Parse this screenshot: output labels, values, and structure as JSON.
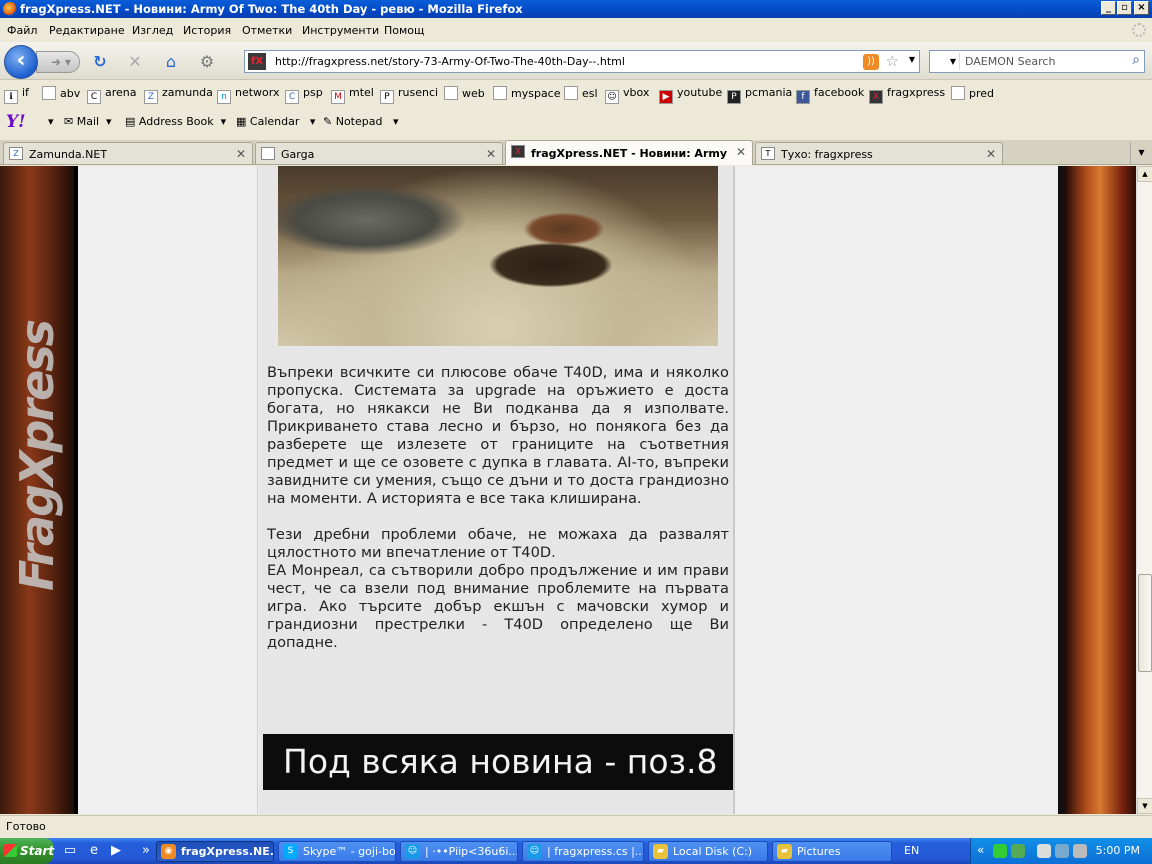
{
  "window": {
    "title": "fragXpress.NET - Новини: Army Of Two: The 40th Day - ревю - Mozilla Firefox"
  },
  "menu": [
    "Файл",
    "Редактиране",
    "Изглед",
    "История",
    "Отметки",
    "Инструменти",
    "Помощ"
  ],
  "nav": {
    "url": "http://fragxpress.net/story-73-Army-Of-Two-The-40th-Day--.html",
    "search_placeholder": "DAEMON Search"
  },
  "bookmarks": [
    "if",
    "abv",
    "arena",
    "zamunda",
    "networx",
    "psp",
    "mtel",
    "rusenci",
    "web",
    "myspace",
    "esl",
    "vbox",
    "youtube",
    "pcmania",
    "facebook",
    "fragxpress",
    "pred"
  ],
  "yahoo_toolbar": {
    "mail": "Mail",
    "address_book": "Address Book",
    "calendar": "Calendar",
    "notepad": "Notepad"
  },
  "tabs": [
    {
      "label": "Zamunda.NET",
      "active": false
    },
    {
      "label": "Garga",
      "active": false
    },
    {
      "label": "fragXpress.NET - Новини: Army O...",
      "active": true
    },
    {
      "label": "Тухо: fragxpress",
      "active": false
    }
  ],
  "article": {
    "p1": "Въпреки всичките си плюсове обаче T40D, има и няколко пропуска. Системата за upgrade на оръжието е доста богата, но някакси не Ви подканва да я изполвате. Прикриването става лесно и бързо, но понякога без да разберете ще излезете от границите на съответния предмет и ще се озовете с дупка в главата. AI-то, въпреки завидните си умения, също се дъни и то доста грандиозно на моменти. А историята е все така клиширана.",
    "p2": "Тези дребни проблеми обаче, не можаха да развалят цялостното ми впечатление от T40D.",
    "p3": "ЕА Монреал, са сътворили добро продължение и им прави чест, че са взели под внимание проблемите на първата игра. Ако търсите добър екшън с мачовски хумор и грандиозни престрелки - T40D определено ще Ви допадне.",
    "banner": "Под всяка новина - поз.8"
  },
  "side_logo": "FragXpress",
  "status": "Готово",
  "taskbar": {
    "start": "Start",
    "tasks": [
      {
        "label": "fragXpress.NE...",
        "active": true
      },
      {
        "label": "Skype™ - goji-boji",
        "active": false
      },
      {
        "label": "| ·••Piip<36u6i...",
        "active": false
      },
      {
        "label": "| fragxpress.cs |...",
        "active": false
      },
      {
        "label": "Local Disk (C:)",
        "active": false
      },
      {
        "label": "Pictures",
        "active": false
      }
    ],
    "lang": "EN",
    "clock": "5:00 PM"
  }
}
